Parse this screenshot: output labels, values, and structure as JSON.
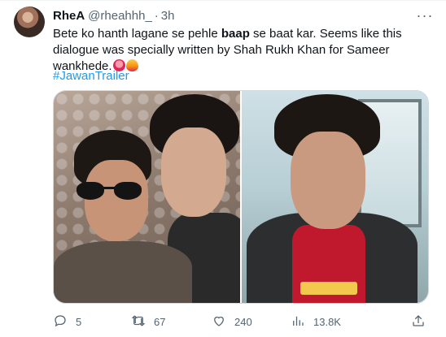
{
  "tweet": {
    "author_name": "RheA",
    "handle": "@rheahhh_",
    "separator": "·",
    "time": "3h",
    "more_label": "···",
    "text_part1": "Bete ko hanth lagane se pehle ",
    "text_bold": "baap",
    "text_part2": " se baat kar. Seems like this dialogue was specially written by Shah Rukh Khan for Sameer wankhede.",
    "hashtag": "#JawanTrailer"
  },
  "actions": {
    "reply_count": "5",
    "retweet_count": "67",
    "like_count": "240",
    "views_count": "13.8K"
  },
  "icons": {
    "more": "ellipsis-icon",
    "reply": "reply-icon",
    "retweet": "retweet-icon",
    "like": "heart-icon",
    "views": "views-icon",
    "share": "share-icon"
  },
  "colors": {
    "text": "#0f1419",
    "secondary": "#536471",
    "link": "#1d9bf0"
  }
}
